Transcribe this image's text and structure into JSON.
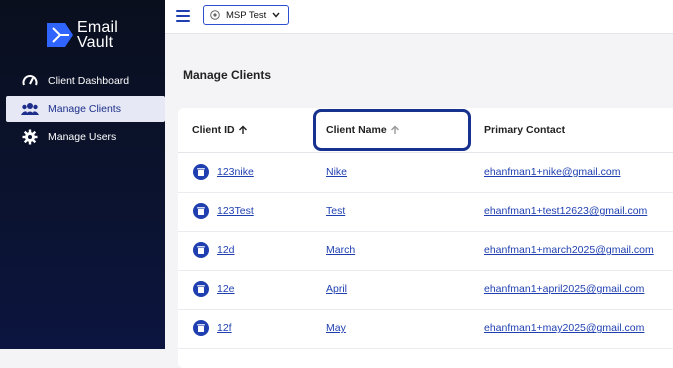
{
  "brand": {
    "name_line1": "Email",
    "name_line2": "Vault"
  },
  "sidebar": {
    "items": [
      {
        "label": "Client Dashboard",
        "icon": "speedometer-icon",
        "active": false
      },
      {
        "label": "Manage Clients",
        "icon": "users-icon",
        "active": true
      },
      {
        "label": "Manage Users",
        "icon": "gear-icon",
        "active": false
      }
    ]
  },
  "topbar": {
    "org_selector": "MSP Test"
  },
  "page": {
    "title": "Manage Clients"
  },
  "table": {
    "columns": [
      "Client ID",
      "Client Name",
      "Primary Contact"
    ],
    "rows": [
      {
        "id": "123nike",
        "name": "Nike",
        "contact": "ehanfman1+nike@gmail.com"
      },
      {
        "id": "123Test",
        "name": "Test",
        "contact": "ehanfman1+test12623@gmail.com"
      },
      {
        "id": "12d",
        "name": "March",
        "contact": "ehanfman1+march2025@gmail.com"
      },
      {
        "id": "12e",
        "name": "April",
        "contact": "ehanfman1+april2025@gmail.com"
      },
      {
        "id": "12f",
        "name": "May",
        "contact": "ehanfman1+may2025@gmail.com"
      }
    ]
  },
  "colors": {
    "accent": "#1f3fb0",
    "highlight": "#17318f",
    "sidebar_bg": "#0b1330"
  }
}
